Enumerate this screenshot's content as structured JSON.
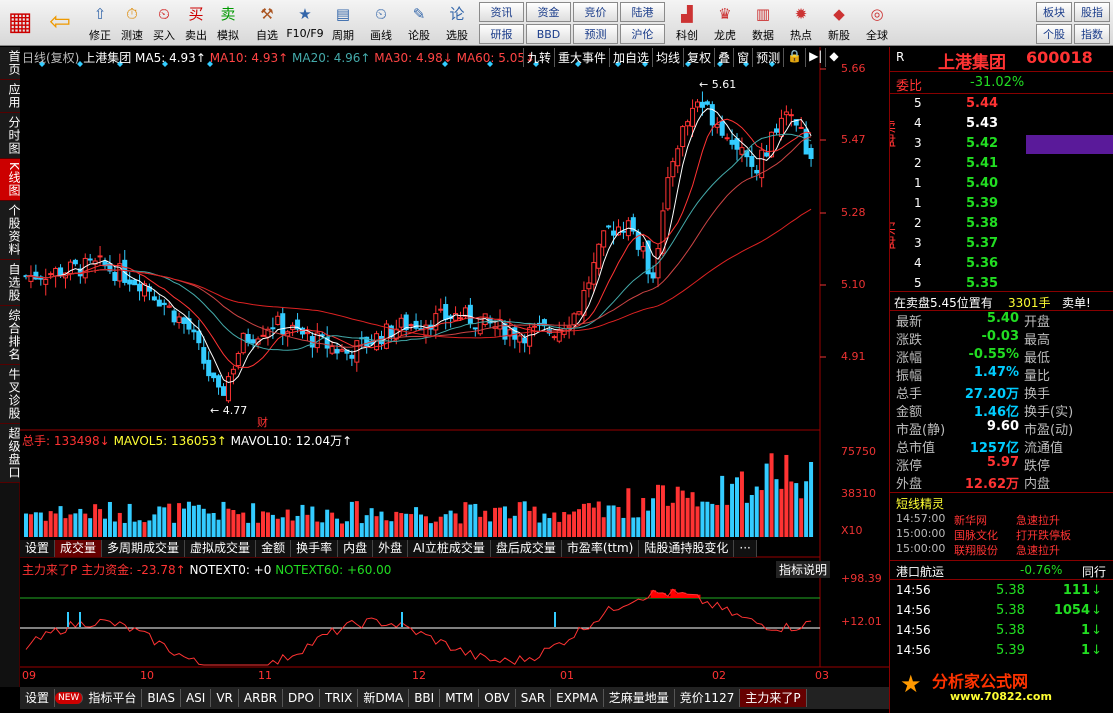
{
  "toolbar": {
    "buttons": [
      {
        "label": "",
        "icon": "grid-icon"
      },
      {
        "label": "",
        "icon": "back-arrow-icon"
      },
      {
        "label": "修正"
      },
      {
        "label": "测速"
      },
      {
        "label": "买入"
      },
      {
        "label": "卖出"
      },
      {
        "label": "模拟"
      },
      {
        "label": "自选"
      },
      {
        "label": "F10/F9"
      },
      {
        "label": "周期"
      },
      {
        "label": "画线"
      },
      {
        "label": "论股"
      },
      {
        "label": "选股"
      }
    ],
    "grid": [
      "资讯",
      "资金",
      "竞价",
      "陆港",
      "研报",
      "BBD",
      "预测",
      "沪伦"
    ],
    "buttons2": [
      {
        "label": "科创"
      },
      {
        "label": "龙虎"
      },
      {
        "label": "数据"
      },
      {
        "label": "热点"
      },
      {
        "label": "新股"
      },
      {
        "label": "全球"
      }
    ],
    "grid2": [
      "板块",
      "股指",
      "个股",
      "指数"
    ]
  },
  "sidetabs": [
    "首页",
    "应用",
    "分时图",
    "K线图",
    "个股资料",
    "自选股",
    "综合排名",
    "牛叉诊股",
    "超级盘口"
  ],
  "kchart": {
    "header": {
      "period": "日线(复权)",
      "name": "上港集团",
      "ma5": "MA5: 4.93↑",
      "ma10": "MA10: 4.93↑",
      "ma20": "MA20: 4.96↑",
      "ma30": "MA30: 4.98↓",
      "ma60": "MA60: 5.05↓"
    },
    "tabs": [
      "九转",
      "重大事件",
      "加自选",
      "均线",
      "复权",
      "叠",
      "窗",
      "预测",
      "🔒",
      "▶|",
      "◆"
    ],
    "ylabels": [
      "5.66",
      "5.47",
      "5.28",
      "5.10",
      "4.91"
    ],
    "high_label": "5.61",
    "low_label": "4.77",
    "fin_marker": "财"
  },
  "volume": {
    "header": {
      "total": "总手: 133498↓",
      "mavol5": "MAVOL5: 136053↑",
      "mavol10": "MAVOL10: 12.04万↑"
    },
    "ylabels": [
      "75750",
      "38310"
    ],
    "unit": "X10"
  },
  "subtabs": [
    "设置",
    "成交量",
    "多周期成交量",
    "虚拟成交量",
    "金额",
    "换手率",
    "内盘",
    "外盘",
    "AI立桩成交量",
    "盘后成交量",
    "市盈率(ttm)",
    "陆股通持股变化",
    "···"
  ],
  "indicator": {
    "header": {
      "name": "主力来了P",
      "main": "主力资金: -23.78↑",
      "notext0": "NOTEXT0: +0",
      "notext60": "NOTEXT60: +60.00"
    },
    "help": "指标说明",
    "ylabels": [
      "+98.39",
      "+12.01"
    ]
  },
  "xaxis": [
    "09",
    "10",
    "11",
    "12",
    "01",
    "02",
    "03"
  ],
  "bottombar": [
    "设置",
    "NEW",
    "指标平台",
    "BIAS",
    "ASI",
    "VR",
    "ARBR",
    "DPO",
    "TRIX",
    "新DMA",
    "BBI",
    "MTM",
    "OBV",
    "SAR",
    "EXPMA",
    "芝麻量地量",
    "竞价1127",
    "主力来了P"
  ],
  "quote": {
    "flag": "R",
    "name": "上港集团",
    "code": "600018",
    "weibi_label": "委比",
    "weibi": "-31.02%",
    "sell_label": "卖盘",
    "buy_label": "买盘",
    "sells": [
      {
        "lv": "5",
        "price": "5.44"
      },
      {
        "lv": "4",
        "price": "5.43"
      },
      {
        "lv": "3",
        "price": "5.42"
      },
      {
        "lv": "2",
        "price": "5.41"
      },
      {
        "lv": "1",
        "price": "5.40"
      }
    ],
    "buys": [
      {
        "lv": "1",
        "price": "5.39"
      },
      {
        "lv": "2",
        "price": "5.38"
      },
      {
        "lv": "3",
        "price": "5.37"
      },
      {
        "lv": "4",
        "price": "5.36"
      },
      {
        "lv": "5",
        "price": "5.35"
      }
    ],
    "order_note": "在卖盘5.45位置有",
    "order_qty": "3301手",
    "order_type": "卖单!",
    "stats": [
      {
        "l1": "最新",
        "v1": "5.40",
        "l2": "开盘",
        "c": "grn"
      },
      {
        "l1": "涨跌",
        "v1": "-0.03",
        "l2": "最高",
        "c": "grn"
      },
      {
        "l1": "涨幅",
        "v1": "-0.55%",
        "l2": "最低",
        "c": "grn"
      },
      {
        "l1": "振幅",
        "v1": "1.47%",
        "l2": "量比",
        "c": "cyn"
      },
      {
        "l1": "总手",
        "v1": "27.20万",
        "l2": "换手",
        "c": "cyn"
      },
      {
        "l1": "金额",
        "v1": "1.46亿",
        "l2": "换手(实)",
        "c": "cyn"
      },
      {
        "l1": "市盈(静)",
        "v1": "9.60",
        "l2": "市盈(动)",
        "c": "wht"
      },
      {
        "l1": "总市值",
        "v1": "1257亿",
        "l2": "流通值",
        "c": "cyn"
      },
      {
        "l1": "涨停",
        "v1": "5.97",
        "l2": "跌停",
        "c": "red"
      },
      {
        "l1": "外盘",
        "v1": "12.62万",
        "l2": "内盘",
        "c": "red"
      }
    ],
    "short_title": "短线精灵",
    "short_list": [
      {
        "t": "14:57:00",
        "n": "新华网",
        "e": "急速拉升"
      },
      {
        "t": "15:00:00",
        "n": "国脉文化",
        "e": "打开跌停板"
      },
      {
        "t": "15:00:00",
        "n": "联翔股份",
        "e": "急速拉升"
      }
    ],
    "sector_name": "港口航运",
    "sector_chg": "-0.76%",
    "sector_tab": "同行",
    "ticks": [
      {
        "t": "14:56",
        "p": "5.38",
        "v": "111",
        "d": "↓",
        "c": "grn"
      },
      {
        "t": "14:56",
        "p": "5.38",
        "v": "1054",
        "d": "↓",
        "c": "grn"
      },
      {
        "t": "14:56",
        "p": "5.38",
        "v": "1",
        "d": "↓",
        "c": "grn"
      },
      {
        "t": "14:56",
        "p": "5.39",
        "v": "1",
        "d": "↓",
        "c": "grn"
      }
    ],
    "logo_text": "分析家公式网",
    "logo_url": "www.70822.com"
  }
}
